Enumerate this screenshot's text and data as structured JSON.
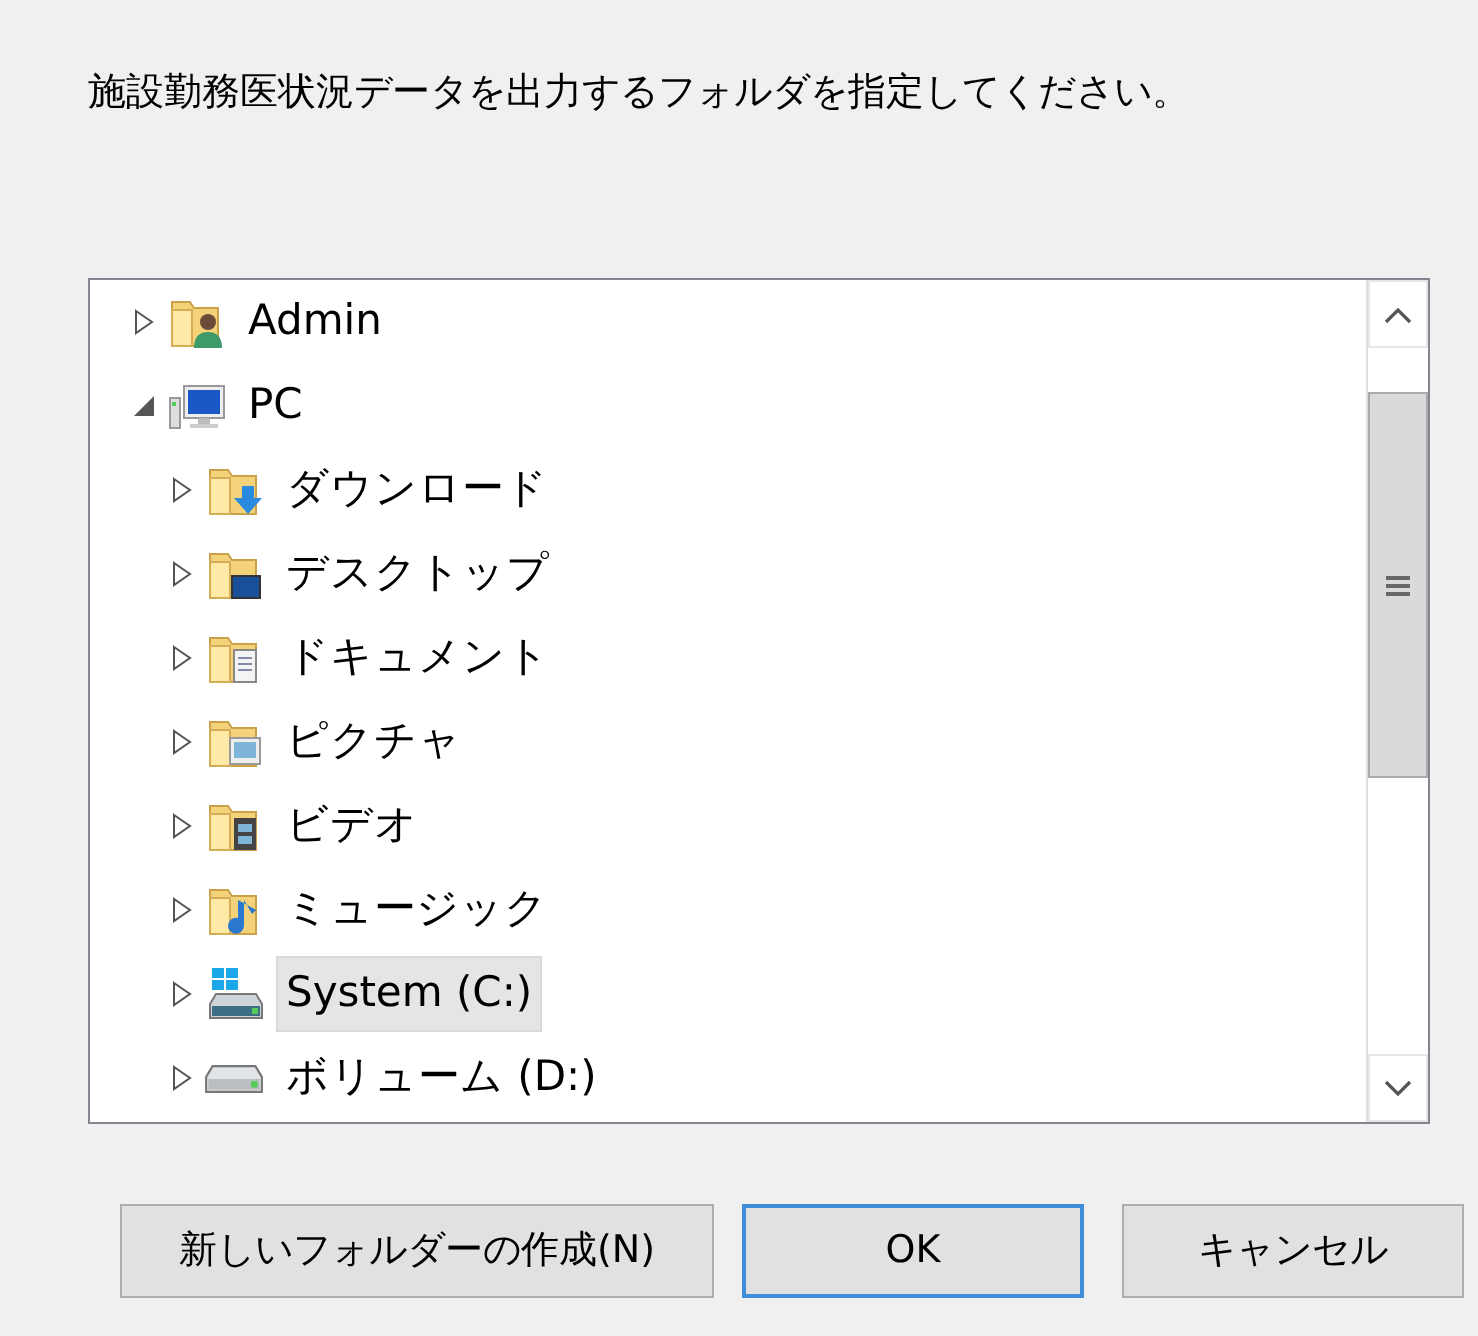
{
  "message": "施設勤務医状況データを出力するフォルダを指定してください。",
  "tree": [
    {
      "label": "Admin",
      "kind": "user-folder",
      "expanded": false,
      "selected": false
    },
    {
      "label": "PC",
      "kind": "computer",
      "expanded": true,
      "selected": false,
      "children": [
        {
          "label": "ダウンロード",
          "kind": "downloads",
          "expanded": false,
          "selected": false
        },
        {
          "label": "デスクトップ",
          "kind": "desktop",
          "expanded": false,
          "selected": false
        },
        {
          "label": "ドキュメント",
          "kind": "documents",
          "expanded": false,
          "selected": false
        },
        {
          "label": "ピクチャ",
          "kind": "pictures",
          "expanded": false,
          "selected": false
        },
        {
          "label": "ビデオ",
          "kind": "videos",
          "expanded": false,
          "selected": false
        },
        {
          "label": "ミュージック",
          "kind": "music",
          "expanded": false,
          "selected": false
        },
        {
          "label": "System (C:)",
          "kind": "system-drive",
          "expanded": false,
          "selected": true
        },
        {
          "label": "ボリューム (D:)",
          "kind": "drive",
          "expanded": false,
          "selected": false
        }
      ]
    }
  ],
  "buttons": [
    {
      "label": "新しいフォルダーの作成(N)",
      "default": false
    },
    {
      "label": "OK",
      "default": true
    },
    {
      "label": "キャンセル",
      "default": false
    }
  ]
}
